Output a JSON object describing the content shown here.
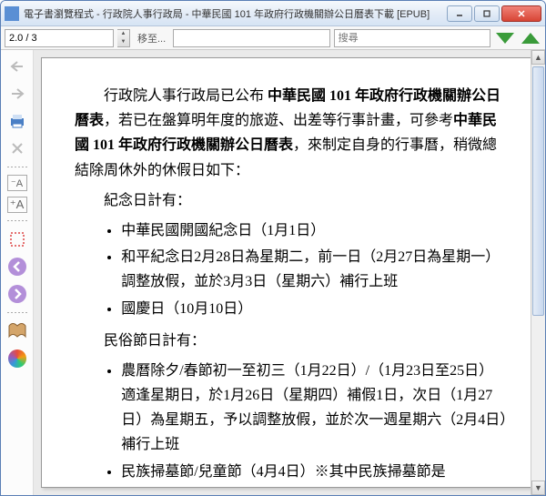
{
  "titlebar": {
    "text": "電子書瀏覽程式 - 行政院人事行政局 - 中華民國 101 年政府行政機關辦公日曆表下載 [EPUB]"
  },
  "toolbar": {
    "page_value": "2.0 / 3",
    "goto_label": "移至...",
    "search_placeholder": "搜尋"
  },
  "document": {
    "intro": {
      "t1": "行政院人事行政局已公布 ",
      "b1": "中華民國 101 年政府行政機關辦公日曆表",
      "t2": "，若已在盤算明年度的旅遊、出差等行事計畫，可參考",
      "b2": "中華民國 101 年政府行政機關辦公日曆表",
      "t3": "，來制定自身的行事曆，稍微總結除周休外的休假日如下："
    },
    "section1": "紀念日計有：",
    "list1": [
      "中華民國開國紀念日（1月1日）",
      "和平紀念日2月28日為星期二，前一日（2月27日為星期一）調整放假，並於3月3日（星期六）補行上班",
      "國慶日（10月10日）"
    ],
    "section2": "民俗節日計有：",
    "list2": [
      "農曆除夕/春節初一至初三（1月22日）/（1月23日至25日）適逢星期日，於1月26日（星期四）補假1日，次日（1月27日）為星期五，予以調整放假，並於次一週星期六（2月4日）補行上班",
      "民族掃墓節/兒童節（4月4日）※其中民族掃墓節是"
    ]
  }
}
